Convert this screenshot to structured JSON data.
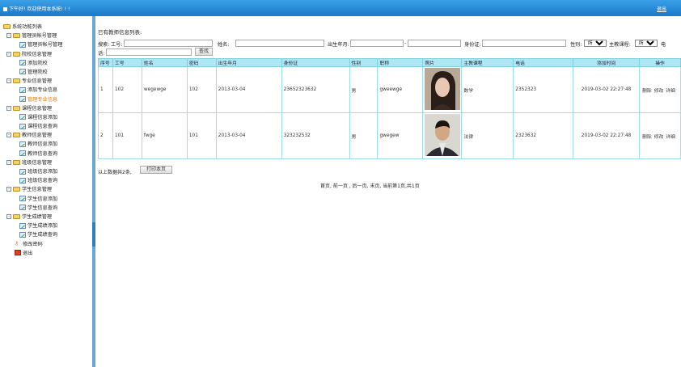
{
  "header": {
    "greeting": "下午好! 欢迎使用本系统! ! !",
    "logout": "退出"
  },
  "sidebar": {
    "root": "系统功能列表",
    "groups": [
      {
        "label": "管理员帐号管理",
        "items": [
          "管理员帐号管理"
        ]
      },
      {
        "label": "院校信息管理",
        "items": [
          "添加院校",
          "管理院校"
        ]
      },
      {
        "label": "专业信息管理",
        "items": [
          "添加专业信息",
          "管理专业信息"
        ]
      },
      {
        "label": "课程信息管理",
        "items": [
          "课程信息添加",
          "课程信息查询"
        ]
      },
      {
        "label": "教师信息管理",
        "items": [
          "教师信息添加",
          "教师信息查询"
        ]
      },
      {
        "label": "班级信息管理",
        "items": [
          "班级信息添加",
          "班级信息查询"
        ]
      },
      {
        "label": "学生信息管理",
        "items": [
          "学生信息添加",
          "学生信息查询"
        ]
      },
      {
        "label": "学生成绩管理",
        "items": [
          "学生成绩添加",
          "学生成绩查询"
        ]
      }
    ],
    "change_password": "修改密码",
    "exit": "退出"
  },
  "main": {
    "title": "已有教师信息列表:",
    "search": {
      "prefix": "搜索:",
      "job_no_label": "工号:",
      "name_label": "姓名:",
      "birth_label": "出生年月:",
      "id_label": "身份证:",
      "gender_label": "性别:",
      "gender_value": "所有",
      "course_label": "主教课程:",
      "course_value": "所有",
      "phone_label_1": "电",
      "phone_label_2": "话:",
      "search_button": "查找"
    },
    "table": {
      "headers": [
        "序号",
        "工号",
        "姓名",
        "密码",
        "出生年月",
        "身份证",
        "性别",
        "职称",
        "照片",
        "主教课程",
        "电话",
        "添加时间",
        "操作"
      ],
      "rows": [
        {
          "no": "1",
          "job_no": "102",
          "name": "wegewge",
          "password": "102",
          "birth": "2013-03-04",
          "id": "23652323632",
          "gender": "男",
          "title": "gweewge",
          "course": "数学",
          "phone": "2352323",
          "added": "2019-03-02 22:27:48",
          "del": "删除",
          "edit": "修改",
          "detail": "详细"
        },
        {
          "no": "2",
          "job_no": "101",
          "name": "fwge",
          "password": "101",
          "birth": "2013-03-04",
          "id": "323232532",
          "gender": "男",
          "title": "gwegew",
          "course": "法律",
          "phone": "2323632",
          "added": "2019-03-02 22:27:48",
          "del": "删除",
          "edit": "修改",
          "detail": "详细"
        }
      ]
    },
    "footer": {
      "total_text": "以上数据共2条,",
      "print_button": "打印本页",
      "pager": "首页, 前一页 , 后一页, 末页, 当前第1页,共1页"
    }
  },
  "colors": {
    "topbar": "#1a78c8",
    "table_header": "#aee6f2",
    "active": "#e07a10"
  }
}
